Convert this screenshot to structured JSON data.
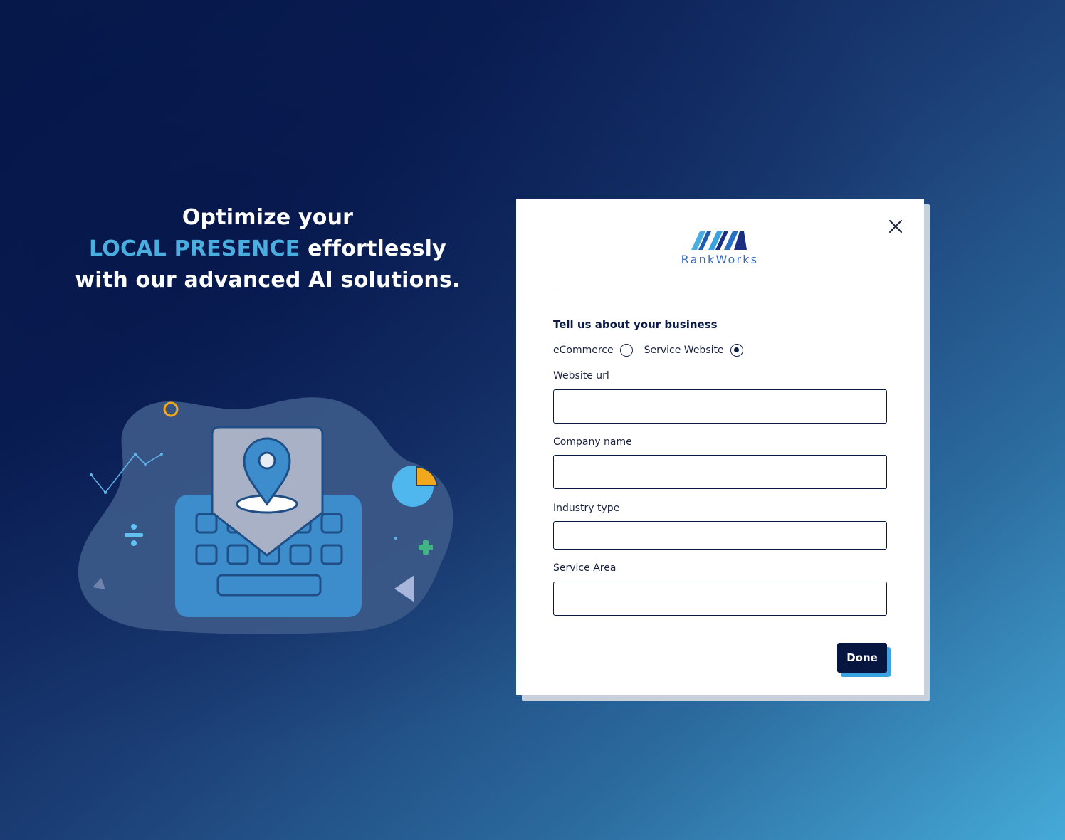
{
  "hero": {
    "line1": "Optimize your",
    "accent": "LOCAL PRESENCE",
    "line2_rest": " effortlessly",
    "line3": "with our advanced AI solutions."
  },
  "brand": {
    "name": "RankWorks",
    "colors": {
      "navy": "#061640",
      "accent": "#4aaee0",
      "button_shadow": "#3aa3e0"
    }
  },
  "form": {
    "title": "Tell us about your business",
    "business_type": {
      "options": [
        {
          "label": "eCommerce",
          "selected": false
        },
        {
          "label": "Service Website",
          "selected": true
        }
      ]
    },
    "fields": {
      "website_url": {
        "label": "Website url",
        "value": ""
      },
      "company_name": {
        "label": "Company name",
        "value": ""
      },
      "industry_type": {
        "label": "Industry type",
        "value": ""
      },
      "service_area": {
        "label": "Service Area",
        "value": ""
      }
    },
    "submit_label": "Done"
  },
  "icons": {
    "close": "close-icon",
    "logo": "rankworks-logo-icon",
    "illustration": "location-pin-keyboard-illustration"
  }
}
